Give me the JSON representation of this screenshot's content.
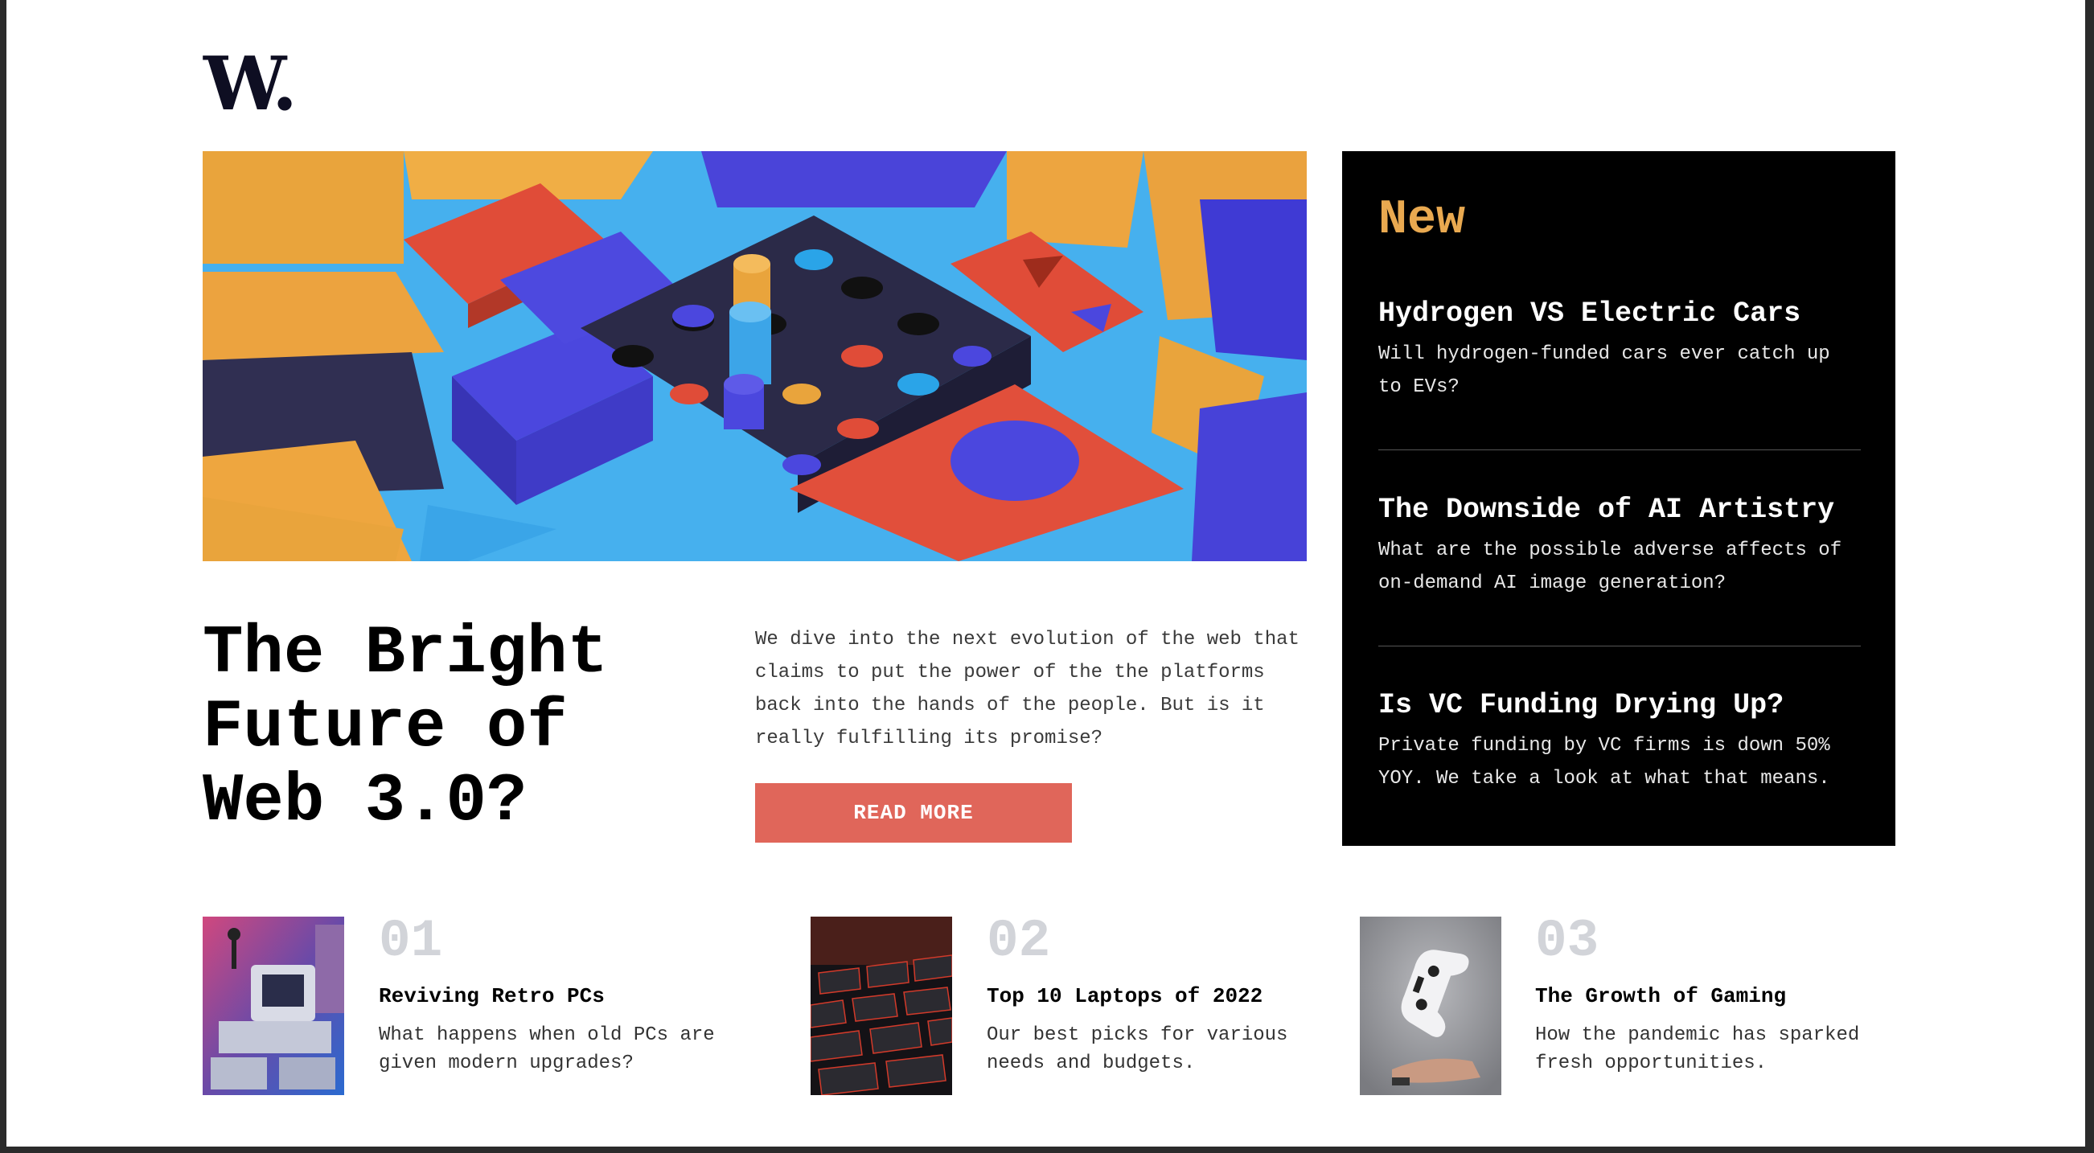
{
  "brand": {
    "logo": "W."
  },
  "hero": {
    "image": "abstract-3d-blocks-illustration",
    "title": "The Bright Future of Web 3.0?",
    "description": "We dive into the next evolution of the web that claims to put the power of the the platforms back into the hands of the people. But is it really fulfilling its promise?",
    "button_label": "READ MORE",
    "button_color": "#e0665a"
  },
  "new_panel": {
    "heading": "New",
    "heading_color": "#e9a950",
    "items": [
      {
        "title": "Hydrogen VS Electric Cars",
        "description": "Will hydrogen-funded cars ever catch up to EVs?"
      },
      {
        "title": "The Downside of AI Artistry",
        "description": "What are the possible adverse affects of on-demand AI image generation?"
      },
      {
        "title": "Is VC Funding Drying Up?",
        "description": "Private funding by VC firms is down 50% YOY. We take a look at what that means."
      }
    ]
  },
  "articles": [
    {
      "number": "01",
      "title": "Reviving Retro PCs",
      "description": "What happens when old PCs are given modern upgrades?",
      "image": "retro-pcs-image"
    },
    {
      "number": "02",
      "title": "Top 10 Laptops of 2022",
      "description": "Our best picks for various needs and budgets.",
      "image": "laptop-keyboard-image"
    },
    {
      "number": "03",
      "title": "The Growth of Gaming",
      "description": "How the pandemic has sparked fresh opportunities.",
      "image": "game-controller-image"
    }
  ]
}
